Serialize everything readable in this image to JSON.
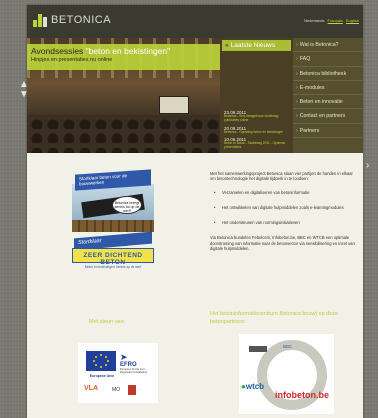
{
  "site": {
    "brand": "BETONICA",
    "languages": [
      {
        "label": "Nederlands",
        "current": true
      },
      {
        "label": "Français",
        "current": false
      },
      {
        "label": "English",
        "current": false
      }
    ]
  },
  "hero": {
    "banner_title_plain": "Avondsessies ",
    "banner_title_highlight": "\"beton en bekistingen\"",
    "banner_subtitle": "Hinpjes en presentaties nu online"
  },
  "news": {
    "title": "Laatste Nieuws",
    "items": [
      {
        "date": "23.09.2011",
        "text": "Betonica - Sint-Jansgebouw studiedag publicaties online"
      },
      {
        "date": "20.09.2011",
        "text": "Betonica - Opleiding beton en bekistingen"
      },
      {
        "date": "10.06.2011",
        "text": "Beton In Bouw - Studiedag 2011 - Opnieuw presentaties"
      }
    ]
  },
  "menu": {
    "items": [
      {
        "label": "Wat is Betonica?"
      },
      {
        "label": "FAQ"
      },
      {
        "label": "Betonica bibliotheek"
      },
      {
        "label": "E-modules"
      },
      {
        "label": "Beton en innovatie"
      },
      {
        "label": "Contact en partners"
      },
      {
        "label": "Partners"
      }
    ]
  },
  "illustrations": {
    "sign_top": "Stortklaar beton voor de bouwwerken",
    "bubble": "Betonica brengt kennis tot op de werf!",
    "sign2_top": "Stortklaar",
    "sign2_mid": "ZEER DICHTEND BETON",
    "sign2_bot": "Beton en bekistingen: kennis op de werf"
  },
  "intro": {
    "paragraph1": "Met het samenwerkingsproject Betonica slaan vier partijen de handen in elkaar om betontechnologie het digitale tijdperk in te loodsen:",
    "bullets": [
      "Verzamelen en digitaliseren van betoninformatie",
      "Het ontwikkelen van digitale hulpmiddelen zoals e-learningmodules",
      "Het ondersteunen van normingsinitiatieven"
    ],
    "paragraph2": "Via Betonica bundelen Febelcem, Infobeton.be, BBC en WTCB een optimale doorstroming van informatie naar de betonsector via sensibilisering en inzet van digitale hulpmiddelen."
  },
  "support": {
    "heading_left": "Met steun van:",
    "heading_right": "Het betoninformatiecentrum Betonica bouwt op deze betonpartners:",
    "eu_label": "Europese Unie",
    "efro_title": "EFRO",
    "efro_sub": "Europees Fonds voor Regionale Ontwikkeling",
    "vla_logos": [
      "VLA",
      "MO",
      "..."
    ],
    "partner_logos": [
      "febelcem",
      "BBC",
      "wtcb",
      "infobeton.be"
    ]
  },
  "colors": {
    "accent": "#b8d23a",
    "header": "#3a3a30",
    "menu": "#56502e",
    "page": "#f1f1e8"
  }
}
